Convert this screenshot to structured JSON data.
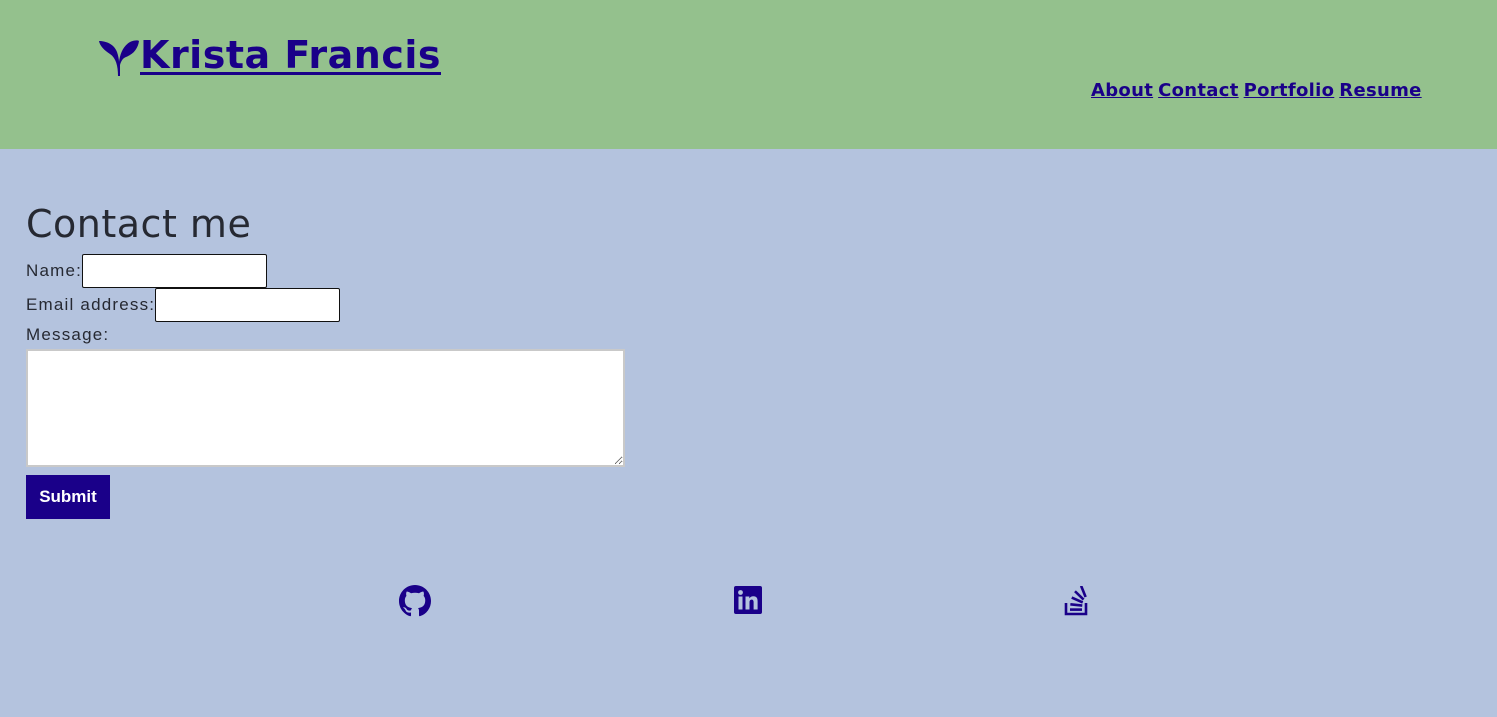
{
  "header": {
    "brand": "Krista Francis",
    "brand_icon": "sprout-icon",
    "nav": [
      {
        "label": "About"
      },
      {
        "label": "Contact"
      },
      {
        "label": "Portfolio"
      },
      {
        "label": "Resume"
      }
    ]
  },
  "contact": {
    "title": "Contact me",
    "name_label": "Name:",
    "name_value": "",
    "email_label": "Email address:",
    "email_value": "",
    "message_label": "Message:",
    "message_value": "",
    "submit_label": "Submit"
  },
  "footer": {
    "links": [
      {
        "icon": "github-icon"
      },
      {
        "icon": "linkedin-icon"
      },
      {
        "icon": "stackoverflow-icon"
      }
    ]
  },
  "colors": {
    "header_bg": "#94c18d",
    "page_bg": "#b4c3de",
    "accent": "#1a0089",
    "text": "#262932"
  }
}
